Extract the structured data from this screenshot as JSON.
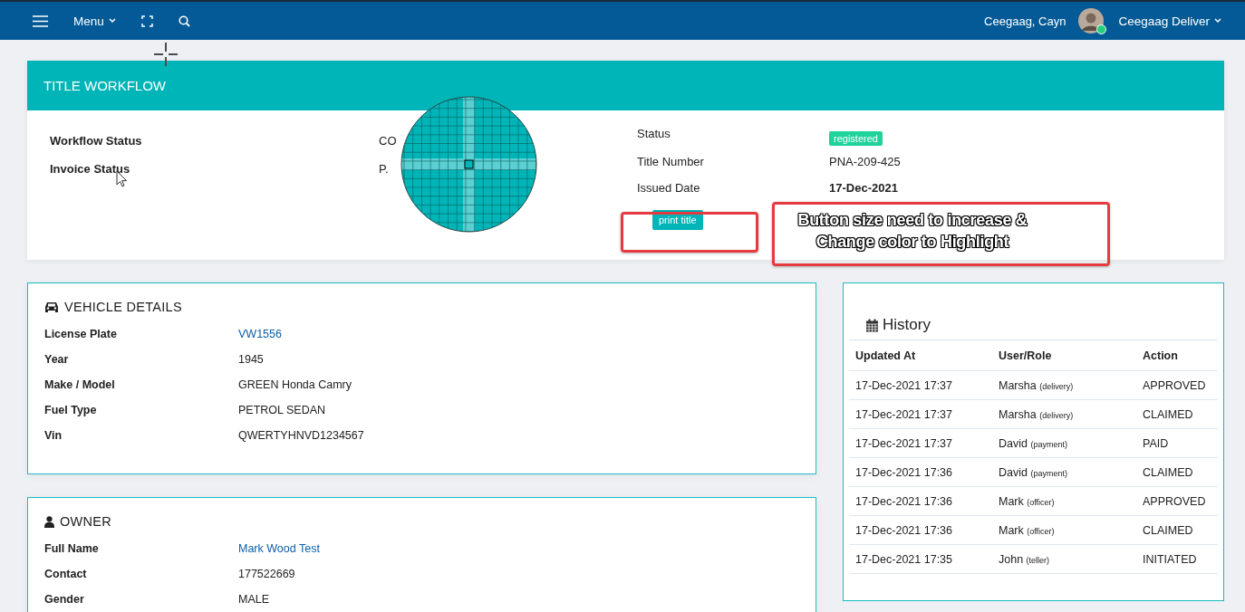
{
  "topbar": {
    "menu": "Menu",
    "user_name": "Ceegaag, Cayn",
    "account": "Ceegaag Deliver",
    "online": true
  },
  "workflow": {
    "title": "TITLE WORKFLOW",
    "left_fields": [
      {
        "label": "Workflow Status",
        "value": "CO"
      },
      {
        "label": "Invoice Status",
        "value": "P."
      }
    ],
    "right_fields": [
      {
        "label": "Status",
        "value": "registered",
        "kind": "badge"
      },
      {
        "label": "Title Number",
        "value": "PNA-209-425",
        "kind": "text"
      },
      {
        "label": "Issued Date",
        "value": "17-Dec-2021",
        "kind": "bold"
      }
    ],
    "print_button": "print title"
  },
  "annotation": {
    "lines": [
      "Button size need to increase &",
      "Change color to Highlight"
    ]
  },
  "vehicle": {
    "title": "VEHICLE DETAILS",
    "fields": [
      {
        "label": "License Plate",
        "value": "VW1556",
        "kind": "link"
      },
      {
        "label": "Year",
        "value": "1945",
        "kind": "text"
      },
      {
        "label": "Make / Model",
        "value": "GREEN Honda Camry",
        "kind": "text"
      },
      {
        "label": "Fuel Type",
        "value": "PETROL SEDAN",
        "kind": "text"
      },
      {
        "label": "Vin",
        "value": "QWERTYHNVD1234567",
        "kind": "text"
      }
    ]
  },
  "owner": {
    "title": "OWNER",
    "fields": [
      {
        "label": "Full Name",
        "value": "Mark Wood Test",
        "kind": "link"
      },
      {
        "label": "Contact",
        "value": "177522669",
        "kind": "text"
      },
      {
        "label": "Gender",
        "value": "MALE",
        "kind": "text"
      }
    ]
  },
  "history": {
    "title": "History",
    "columns": [
      "Updated At",
      "User/Role",
      "Action"
    ],
    "rows": [
      {
        "updated_at": "17-Dec-2021 17:37",
        "user": "Marsha",
        "role": "(delivery)",
        "action": "APPROVED"
      },
      {
        "updated_at": "17-Dec-2021 17:37",
        "user": "Marsha",
        "role": "(delivery)",
        "action": "CLAIMED"
      },
      {
        "updated_at": "17-Dec-2021 17:37",
        "user": "David",
        "role": "(payment)",
        "action": "PAID"
      },
      {
        "updated_at": "17-Dec-2021 17:36",
        "user": "David",
        "role": "(payment)",
        "action": "CLAIMED"
      },
      {
        "updated_at": "17-Dec-2021 17:36",
        "user": "Mark",
        "role": "(officer)",
        "action": "APPROVED"
      },
      {
        "updated_at": "17-Dec-2021 17:36",
        "user": "Mark",
        "role": "(officer)",
        "action": "CLAIMED"
      },
      {
        "updated_at": "17-Dec-2021 17:35",
        "user": "John",
        "role": "(teller)",
        "action": "INITIATED"
      }
    ]
  }
}
